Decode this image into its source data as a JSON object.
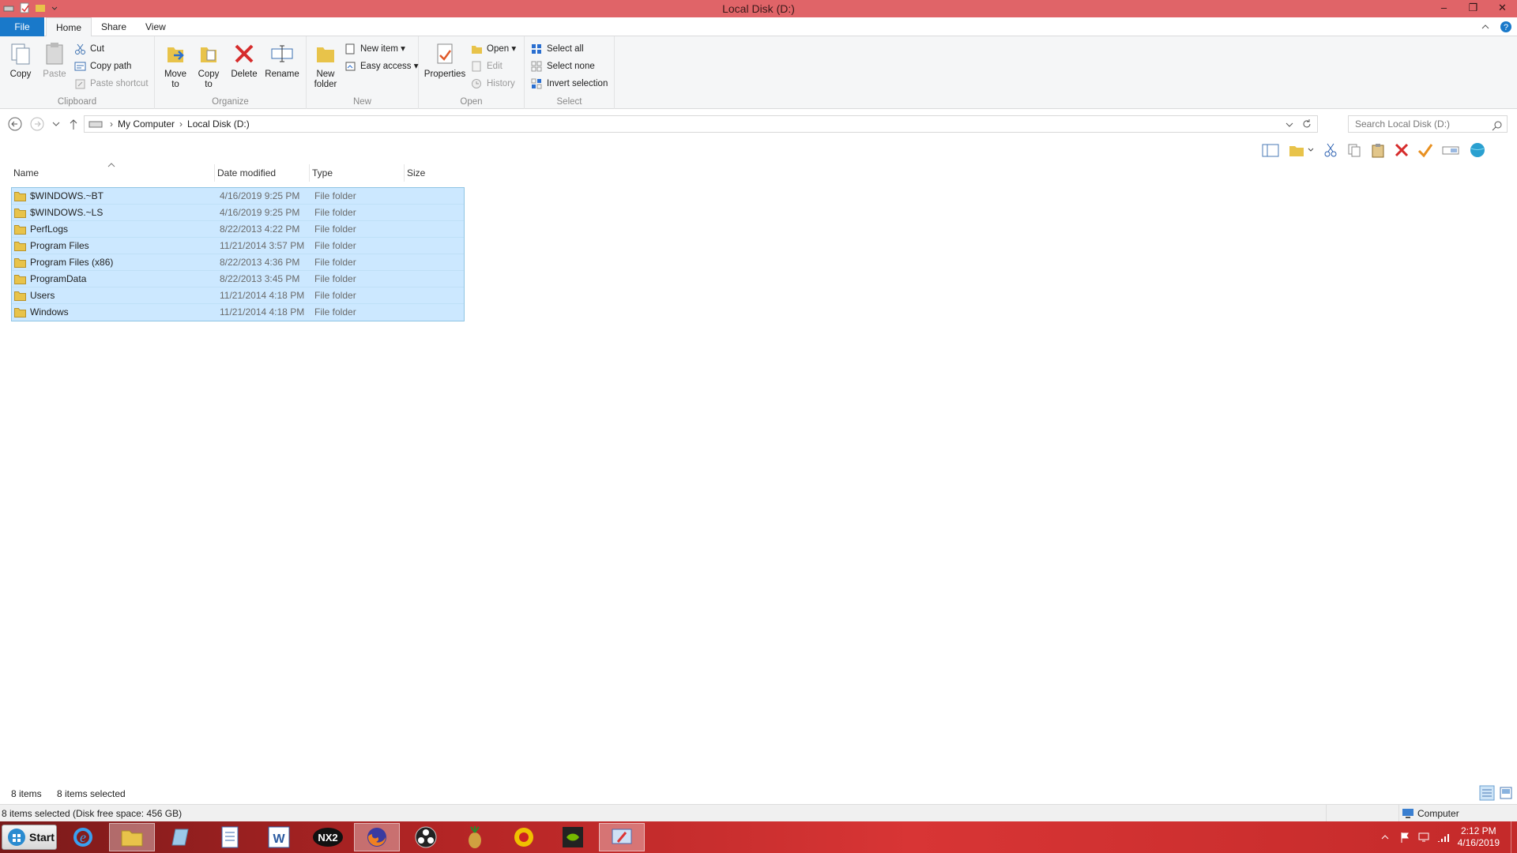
{
  "window": {
    "title": "Local Disk (D:)"
  },
  "tabs": {
    "file": "File",
    "home": "Home",
    "share": "Share",
    "view": "View"
  },
  "ribbon": {
    "clipboard": {
      "label": "Clipboard",
      "copy": "Copy",
      "paste": "Paste",
      "cut": "Cut",
      "copy_path": "Copy path",
      "paste_shortcut": "Paste shortcut"
    },
    "organize": {
      "label": "Organize",
      "move_to_1": "Move",
      "move_to_2": "to",
      "copy_to_1": "Copy",
      "copy_to_2": "to",
      "delete": "Delete",
      "rename": "Rename"
    },
    "new": {
      "label": "New",
      "new_folder_1": "New",
      "new_folder_2": "folder",
      "new_item": "New item",
      "easy_access": "Easy access"
    },
    "open": {
      "label": "Open",
      "properties": "Properties",
      "open": "Open",
      "edit": "Edit",
      "history": "History"
    },
    "select": {
      "label": "Select",
      "select_all": "Select all",
      "select_none": "Select none",
      "invert": "Invert selection"
    }
  },
  "address": {
    "crumbs": [
      "My Computer",
      "Local Disk (D:)"
    ],
    "search_placeholder": "Search Local Disk (D:)"
  },
  "columns": {
    "name": "Name",
    "date": "Date modified",
    "type": "Type",
    "size": "Size"
  },
  "files": [
    {
      "name": "$WINDOWS.~BT",
      "date": "4/16/2019 9:25 PM",
      "type": "File folder"
    },
    {
      "name": "$WINDOWS.~LS",
      "date": "4/16/2019 9:25 PM",
      "type": "File folder"
    },
    {
      "name": "PerfLogs",
      "date": "8/22/2013 4:22 PM",
      "type": "File folder"
    },
    {
      "name": "Program Files",
      "date": "11/21/2014 3:57 PM",
      "type": "File folder"
    },
    {
      "name": "Program Files (x86)",
      "date": "8/22/2013 4:36 PM",
      "type": "File folder"
    },
    {
      "name": "ProgramData",
      "date": "8/22/2013 3:45 PM",
      "type": "File folder"
    },
    {
      "name": "Users",
      "date": "11/21/2014 4:18 PM",
      "type": "File folder"
    },
    {
      "name": "Windows",
      "date": "11/21/2014 4:18 PM",
      "type": "File folder"
    }
  ],
  "status": {
    "count": "8 items",
    "selected": "8 items selected",
    "detail": "8 items selected (Disk free space: 456 GB)",
    "location": "Computer"
  },
  "taskbar": {
    "start": "Start",
    "nx2": "NX2",
    "time": "2:12 PM",
    "date": "4/16/2019"
  },
  "colors": {
    "titlebar": "#e06468",
    "file_tab": "#1979ca",
    "selection": "#cce8ff",
    "taskbar": "#c42a2a"
  }
}
